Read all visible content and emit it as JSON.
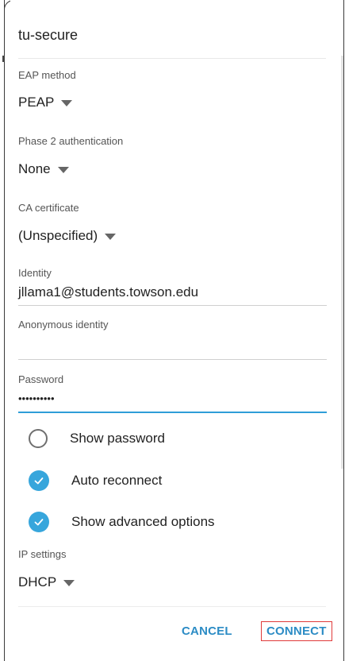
{
  "dialog": {
    "title": "tu-secure",
    "eap_method": {
      "label": "EAP method",
      "value": "PEAP"
    },
    "phase2": {
      "label": "Phase 2 authentication",
      "value": "None"
    },
    "ca_certificate": {
      "label": "CA certificate",
      "value": "(Unspecified)"
    },
    "identity": {
      "label": "Identity",
      "value": "jllama1@students.towson.edu"
    },
    "anonymous_identity": {
      "label": "Anonymous identity",
      "value": ""
    },
    "password": {
      "label": "Password",
      "value": "••••••••••"
    },
    "show_password": {
      "label": "Show password",
      "checked": false
    },
    "auto_reconnect": {
      "label": "Auto reconnect",
      "checked": true
    },
    "show_advanced": {
      "label": "Show advanced options",
      "checked": true
    },
    "ip_settings": {
      "label": "IP settings",
      "value": "DHCP"
    },
    "buttons": {
      "cancel": "CANCEL",
      "connect": "CONNECT"
    }
  },
  "colors": {
    "accent": "#2c8cc5",
    "checkbox": "#37a6dc",
    "highlight_border": "#e03a3a"
  }
}
